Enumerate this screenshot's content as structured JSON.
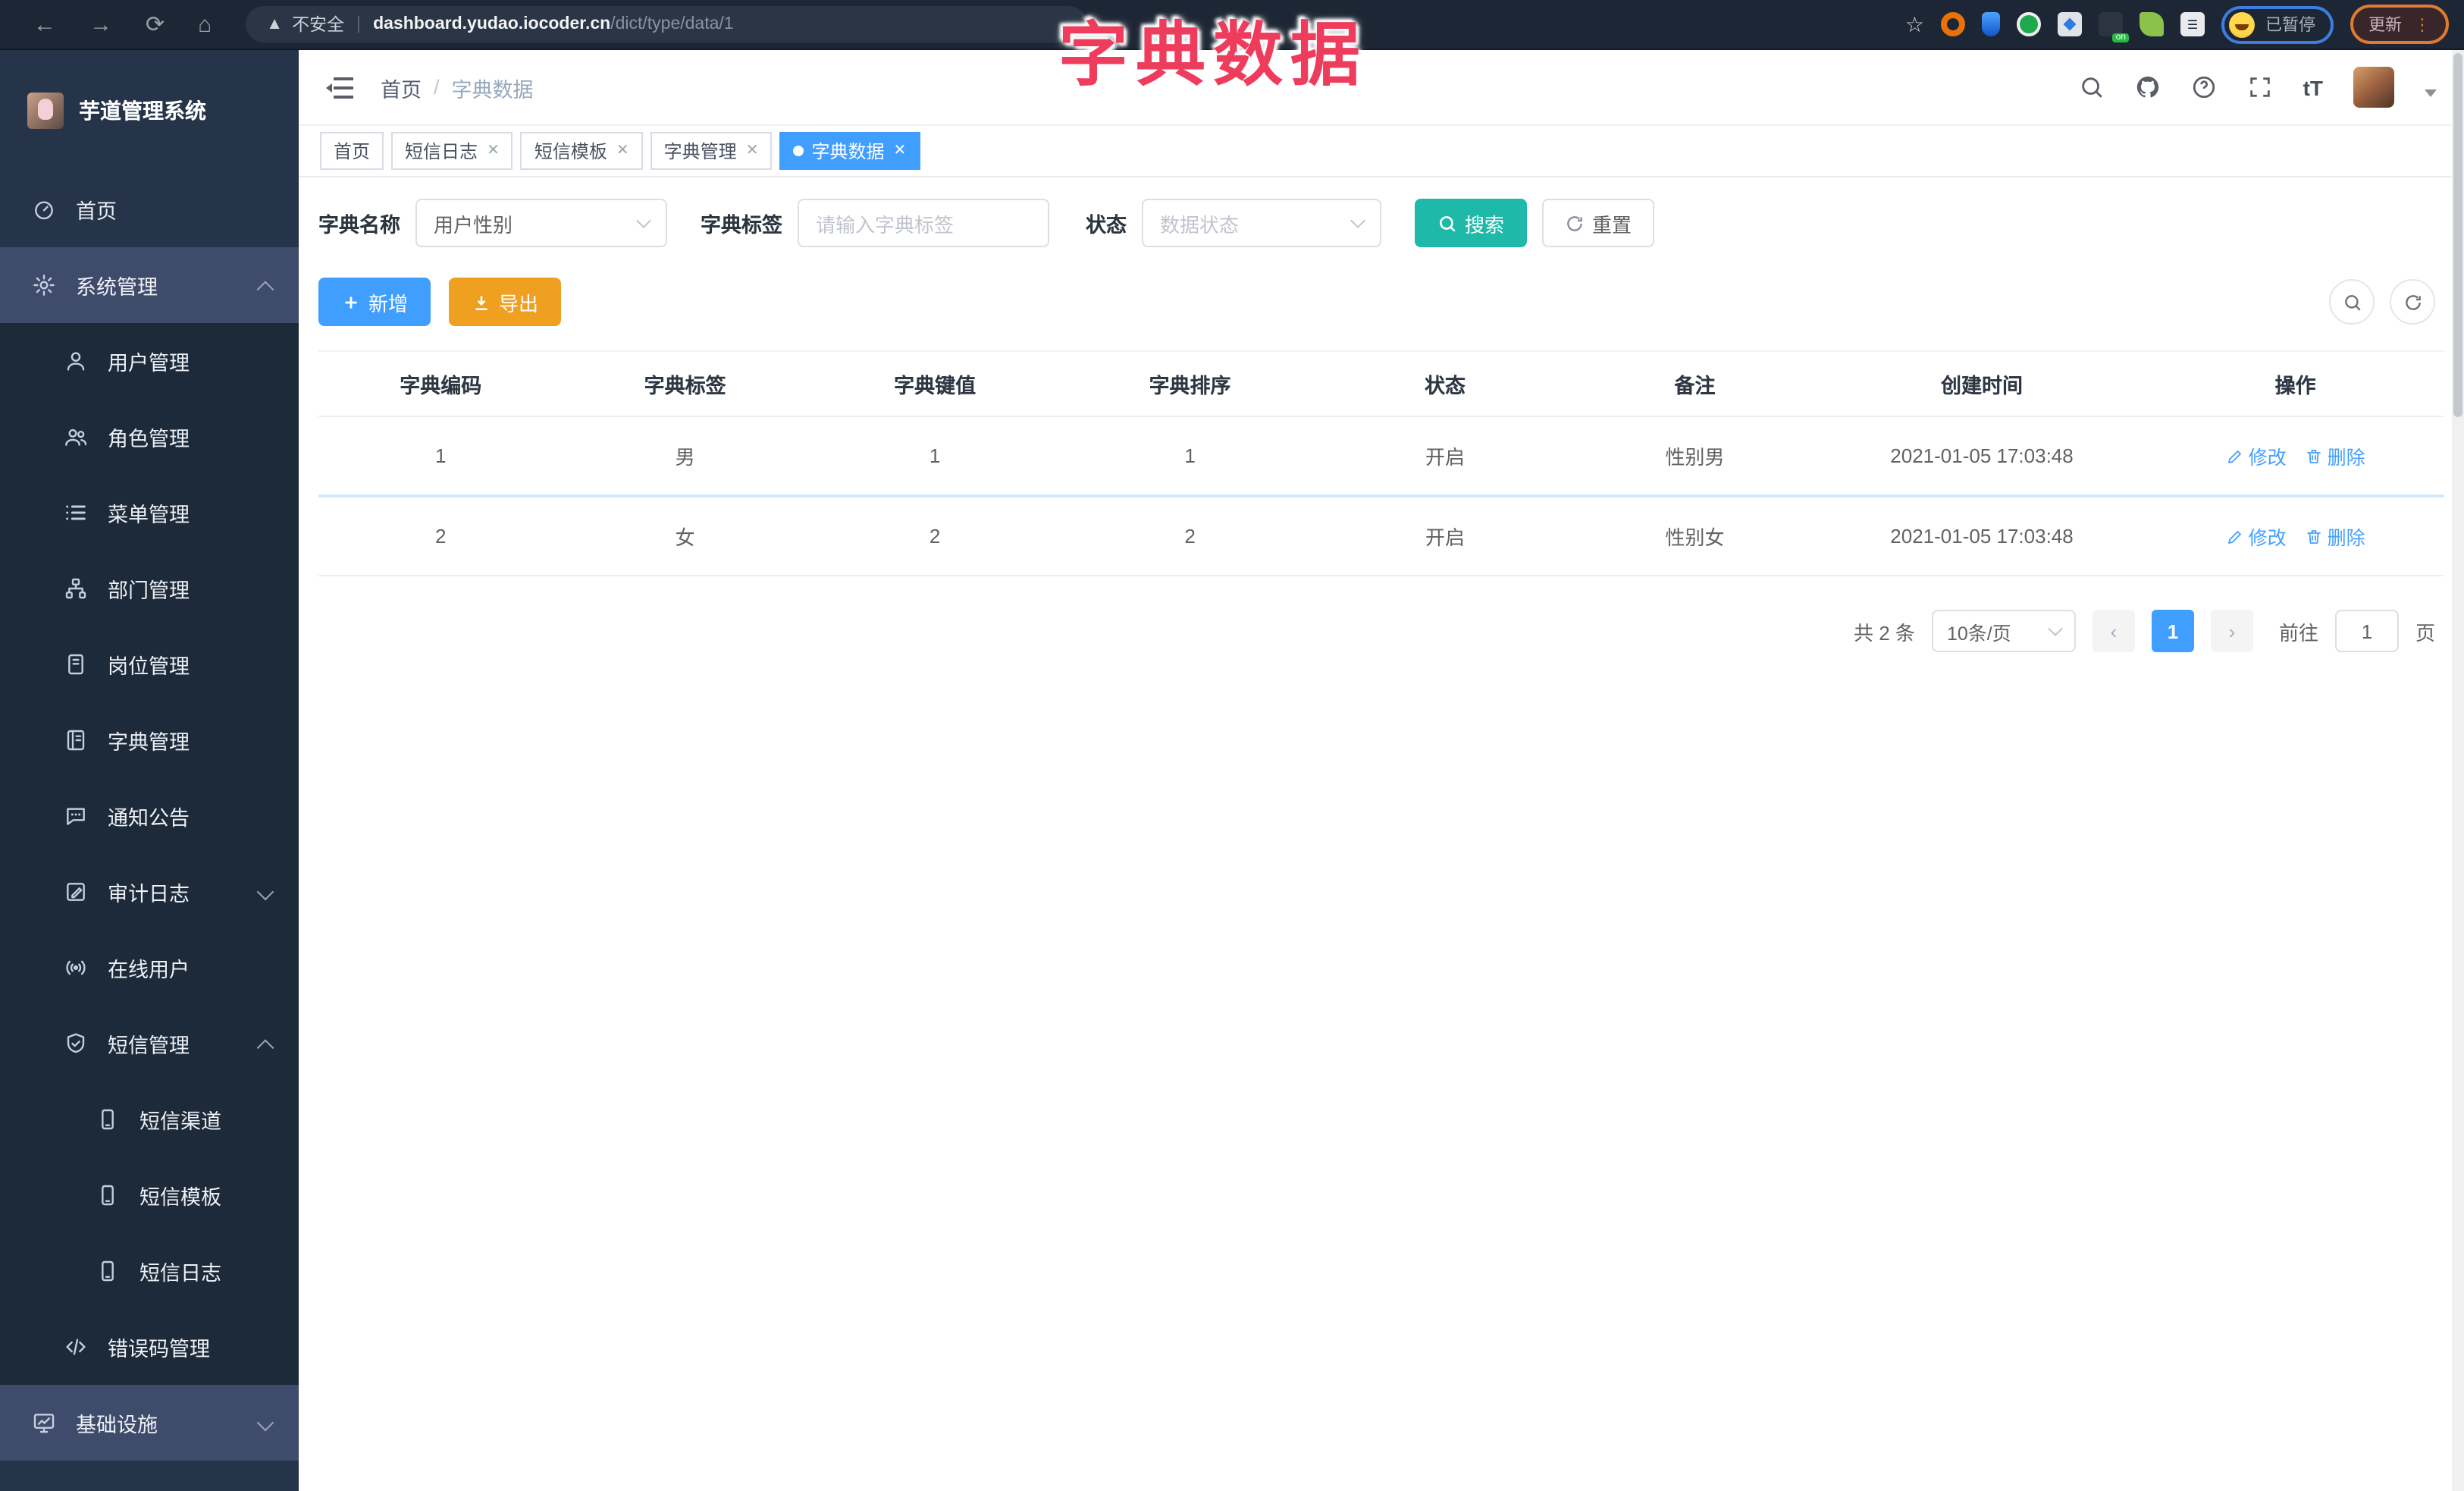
{
  "overlay_title": "字典数据",
  "browser": {
    "security_label": "不安全",
    "url_host": "dashboard.yudao.iocoder.cn",
    "url_path": "/dict/type/data/1",
    "paused_badge": "已暂停",
    "update_label": "更新",
    "extension_icons": [
      "ext-orange-ring",
      "ext-blue-gem",
      "ext-green-check",
      "ext-blue-stats",
      "ext-on-toggle",
      "ext-green-leaf",
      "extensions-puzzle"
    ]
  },
  "sidebar": {
    "logo_title": "芋道管理系统",
    "items": [
      {
        "label": "首页",
        "icon": "dashboard",
        "level": "root",
        "chevron": "",
        "highlight": false
      },
      {
        "label": "系统管理",
        "icon": "gear",
        "level": "root",
        "chevron": "up",
        "highlight": true
      },
      {
        "label": "用户管理",
        "icon": "user",
        "level": "sub",
        "chevron": ""
      },
      {
        "label": "角色管理",
        "icon": "users",
        "level": "sub",
        "chevron": ""
      },
      {
        "label": "菜单管理",
        "icon": "list",
        "level": "sub",
        "chevron": ""
      },
      {
        "label": "部门管理",
        "icon": "tree",
        "level": "sub",
        "chevron": ""
      },
      {
        "label": "岗位管理",
        "icon": "badge",
        "level": "sub",
        "chevron": ""
      },
      {
        "label": "字典管理",
        "icon": "book",
        "level": "sub",
        "chevron": ""
      },
      {
        "label": "通知公告",
        "icon": "chat",
        "level": "sub",
        "chevron": ""
      },
      {
        "label": "审计日志",
        "icon": "audit",
        "level": "sub",
        "chevron": "down"
      },
      {
        "label": "在线用户",
        "icon": "online",
        "level": "sub",
        "chevron": ""
      },
      {
        "label": "短信管理",
        "icon": "shield",
        "level": "sub",
        "chevron": "up"
      },
      {
        "label": "短信渠道",
        "icon": "phone",
        "level": "sub2",
        "chevron": ""
      },
      {
        "label": "短信模板",
        "icon": "phone",
        "level": "sub2",
        "chevron": ""
      },
      {
        "label": "短信日志",
        "icon": "phone",
        "level": "sub2",
        "chevron": ""
      },
      {
        "label": "错误码管理",
        "icon": "code",
        "level": "sub",
        "chevron": ""
      },
      {
        "label": "基础设施",
        "icon": "monitor",
        "level": "root",
        "chevron": "down",
        "highlight": true
      }
    ]
  },
  "navbar": {
    "breadcrumb_home": "首页",
    "breadcrumb_sep": "/",
    "breadcrumb_current": "字典数据",
    "font_size_icon_text": "tT"
  },
  "tabs": [
    {
      "label": "首页",
      "closable": false,
      "active": false
    },
    {
      "label": "短信日志",
      "closable": true,
      "active": false
    },
    {
      "label": "短信模板",
      "closable": true,
      "active": false
    },
    {
      "label": "字典管理",
      "closable": true,
      "active": false
    },
    {
      "label": "字典数据",
      "closable": true,
      "active": true
    }
  ],
  "filters": {
    "name_label": "字典名称",
    "name_value": "用户性别",
    "tag_label": "字典标签",
    "tag_placeholder": "请输入字典标签",
    "status_label": "状态",
    "status_placeholder": "数据状态",
    "search_label": "搜索",
    "reset_label": "重置"
  },
  "toolbar": {
    "add_label": "新增",
    "export_label": "导出"
  },
  "table": {
    "headers": [
      "字典编码",
      "字典标签",
      "字典键值",
      "字典排序",
      "状态",
      "备注",
      "创建时间",
      "操作"
    ],
    "rows": [
      {
        "code": "1",
        "label": "男",
        "value": "1",
        "sort": "1",
        "status": "开启",
        "remark": "性别男",
        "created": "2021-01-05 17:03:48",
        "edit": "修改",
        "delete": "删除"
      },
      {
        "code": "2",
        "label": "女",
        "value": "2",
        "sort": "2",
        "status": "开启",
        "remark": "性别女",
        "created": "2021-01-05 17:03:48",
        "edit": "修改",
        "delete": "删除"
      }
    ]
  },
  "pagination": {
    "total": "共 2 条",
    "page_size": "10条/页",
    "prev": "‹",
    "current_page": "1",
    "next": "›",
    "goto_label": "前往",
    "goto_value": "1",
    "page_unit": "页"
  }
}
